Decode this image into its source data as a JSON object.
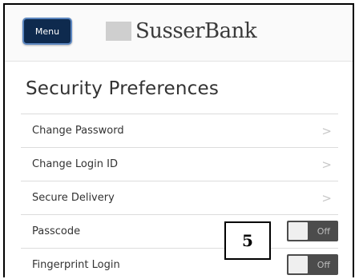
{
  "header": {
    "menu_label": "Menu",
    "brand_name": "SusserBank"
  },
  "page": {
    "title": "Security Preferences"
  },
  "items": [
    {
      "label": "Change Password",
      "control": "chevron"
    },
    {
      "label": "Change Login ID",
      "control": "chevron"
    },
    {
      "label": "Secure Delivery",
      "control": "chevron"
    },
    {
      "label": "Passcode",
      "control": "toggle",
      "state": "Off"
    },
    {
      "label": "Fingerprint Login",
      "control": "toggle",
      "state": "Off"
    }
  ],
  "callout": {
    "number": "5"
  },
  "icons": {
    "chevron": "chevron-right-icon",
    "chevron_glyph": ">"
  },
  "colors": {
    "menu_bg": "#0e2a4e",
    "toggle_bg": "#4c4c4c"
  }
}
